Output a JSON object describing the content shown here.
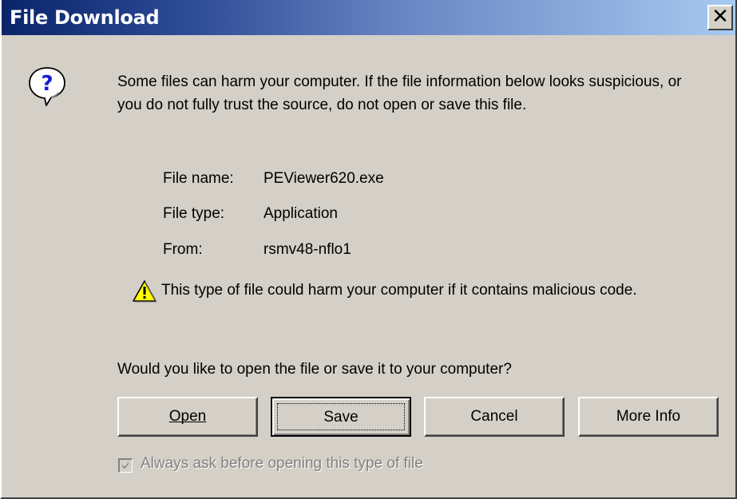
{
  "window": {
    "title": "File Download"
  },
  "message": "Some files can harm your computer. If the file information below looks suspicious, or you do not fully trust the source, do not open or save this file.",
  "file_info": {
    "name_label": "File name:",
    "name_value": "PEViewer620.exe",
    "type_label": "File type:",
    "type_value": "Application",
    "from_label": "From:",
    "from_value": "rsmv48-nflo1"
  },
  "caution": "This type of file could harm your computer if it contains malicious code.",
  "question": "Would you like to open the file or save it to your computer?",
  "buttons": {
    "open": "Open",
    "save": "Save",
    "cancel": "Cancel",
    "more_info": "More Info"
  },
  "checkbox": {
    "label": "Always ask before opening this type of file",
    "checked": true
  },
  "icons": {
    "question": "question-bubble-icon",
    "warning": "warning-triangle-icon"
  }
}
